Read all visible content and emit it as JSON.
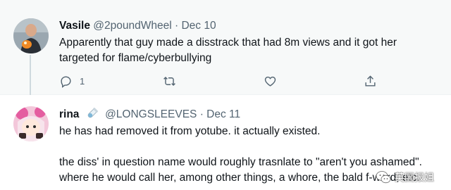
{
  "tweets": [
    {
      "name": "Vasile",
      "handle": "@2poundWheel",
      "separator": "·",
      "date": "Dec 10",
      "text_lines": [
        "Apparently that guy made a disstrack that had 8m views and it got her",
        "targeted for flame/cyberbullying"
      ],
      "reply_count": "1"
    },
    {
      "name": "rina",
      "handle": "@LONGSLEEVES",
      "separator": "·",
      "date": "Dec 11",
      "text_lines": [
        "he has had removed it from yotube. it actually existed.",
        "",
        "the diss' in question name would roughly trasnlate to \"aren't you ashamed\".",
        "where he would call her, among other things, a whore, the bald f-word, etc."
      ]
    }
  ],
  "watermark": {
    "text": "英国报姐"
  },
  "colors": {
    "muted": "#536471",
    "text": "#0f1419",
    "highlight_bg": "#f7f9f9"
  },
  "icons": [
    "reply-icon",
    "retweet-icon",
    "like-icon",
    "share-icon",
    "test-tube-icon",
    "wechat-icon"
  ]
}
